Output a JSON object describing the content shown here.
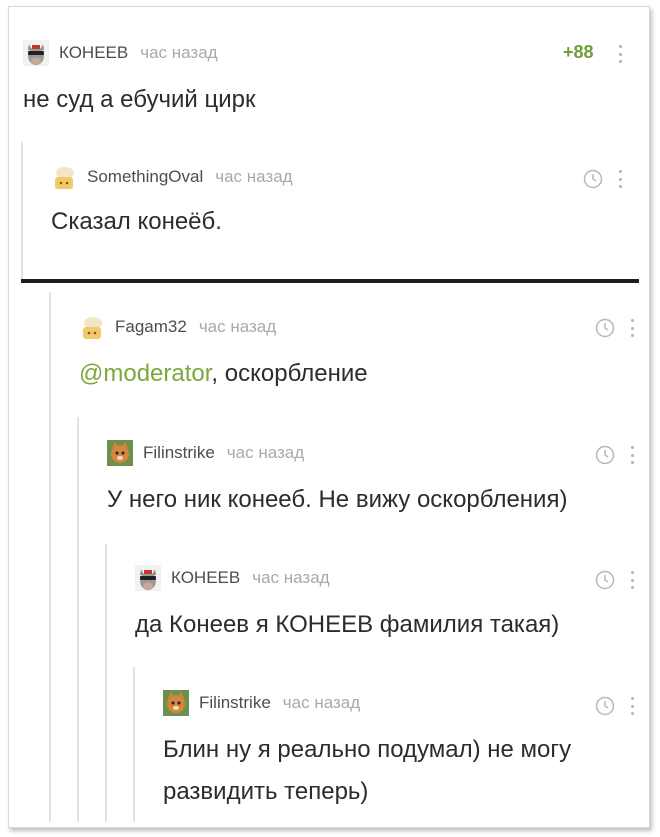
{
  "comments": [
    {
      "nick": "КОНЕЕВ",
      "time": "час назад",
      "text": "не суд а ебучий цирк",
      "rating": "+88",
      "avatar": "donkey-avatar"
    },
    {
      "nick": "SomethingOval",
      "time": "час назад",
      "text": "Сказал конеёб.",
      "avatar": "default-avatar"
    },
    {
      "nick": "Fagam32",
      "time": "час назад",
      "mention": "@moderator",
      "text": ", оскорбление",
      "avatar": "default-avatar"
    },
    {
      "nick": "Filinstrike",
      "time": "час назад",
      "text": "У него ник конееб. Не вижу оскорбления)",
      "avatar": "cat-avatar"
    },
    {
      "nick": "КОНЕЕВ",
      "time": "час назад",
      "text": "да Конеев я КОНЕЕВ фамилия такая)",
      "avatar": "donkey-avatar"
    },
    {
      "nick": "Filinstrike",
      "time": "час назад",
      "text_line1": "Блин ну я реально подумал) не могу",
      "text_line2": "развидить теперь)",
      "avatar": "cat-avatar"
    }
  ],
  "colors": {
    "rating": "#6f9d3a",
    "mention": "#7ca83c",
    "time": "#a9a9a9",
    "divider": "#1e1e1e"
  }
}
